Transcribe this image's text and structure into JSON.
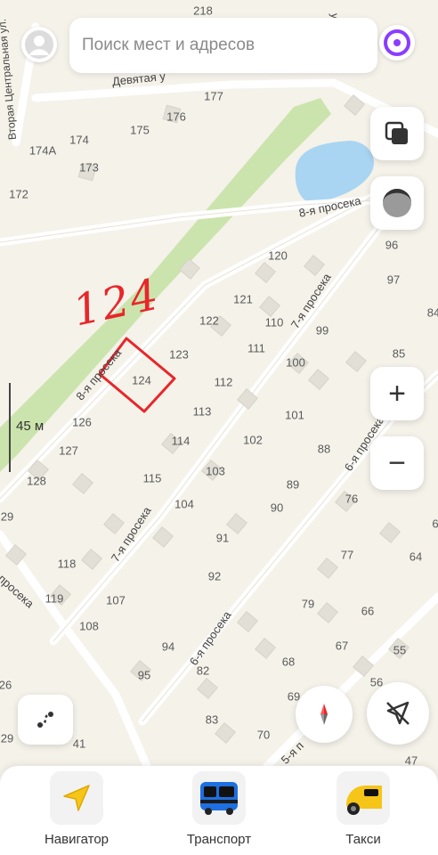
{
  "search": {
    "placeholder": "Поиск мест и адресов"
  },
  "map": {
    "houses": [
      "218",
      "177",
      "176",
      "175",
      "174",
      "174А",
      "173",
      "172",
      "120",
      "96",
      "97",
      "84",
      "121",
      "122",
      "110",
      "99",
      "123",
      "111",
      "85",
      "100",
      "112",
      "124",
      "113",
      "101",
      "126",
      "114",
      "102",
      "88",
      "127",
      "115",
      "103",
      "89",
      "128",
      "104",
      "90",
      "76",
      "29",
      "118",
      "91",
      "77",
      "64",
      "92",
      "119",
      "107",
      "79",
      "66",
      "108",
      "94",
      "67",
      "55",
      "82",
      "95",
      "68",
      "26",
      "83",
      "69",
      "56",
      "41",
      "29",
      "70",
      "47",
      "6"
    ],
    "streets": {
      "devyataya": "Девятая у",
      "vtoraya": "Вторая Центральная ул.",
      "ul_top": "ул.",
      "prosek8_top": "8-я просека",
      "prosek8_left": "8-я просека",
      "prosek7_a": "7-я просека",
      "prosek7_b": "7-я просека",
      "prosek6_a": "6-я просека",
      "prosek6_b": "6-я просека",
      "prosek5": "5-я п",
      "prosek_left": "просека"
    },
    "annotation": "124",
    "scale_label": "45 м"
  },
  "controls": {
    "zoom_in": "+",
    "zoom_out": "−"
  },
  "tabs": [
    {
      "label": "Навигатор"
    },
    {
      "label": "Транспорт"
    },
    {
      "label": "Такси"
    }
  ],
  "colors": {
    "map_bg": "#f5f2ea",
    "park": "#c9e3a8",
    "water": "#a8d4f0",
    "road": "#ffffff",
    "annotation": "#e8262a",
    "alice": "#8a3dff"
  }
}
